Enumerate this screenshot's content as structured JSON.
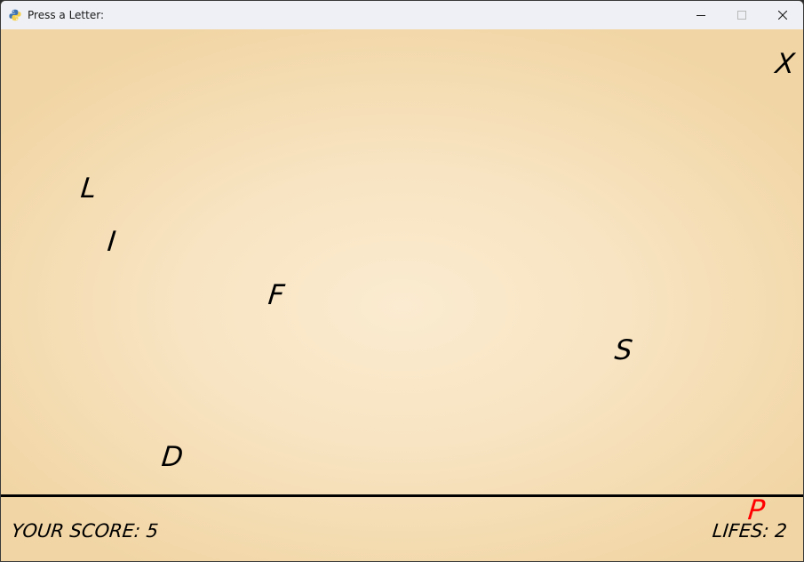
{
  "window": {
    "title": "Press a Letter:",
    "app_icon": "python-icon"
  },
  "controls": {
    "minimize_icon": "minimize-icon",
    "maximize_icon": "maximize-icon",
    "close_icon": "close-icon"
  },
  "game": {
    "falling_letters": [
      {
        "char": "X",
        "color": "#000000"
      },
      {
        "char": "L",
        "color": "#000000"
      },
      {
        "char": "I",
        "color": "#000000"
      },
      {
        "char": "F",
        "color": "#000000"
      },
      {
        "char": "S",
        "color": "#000000"
      },
      {
        "char": "D",
        "color": "#000000"
      },
      {
        "char": "P",
        "color": "#ff0000"
      }
    ],
    "score_text": "YOUR SCORE: 5",
    "lives_text": "LIFES: 2",
    "colors": {
      "background": "#f8e4c2",
      "ground_line": "#000000",
      "missed_letter": "#ff0000"
    }
  }
}
